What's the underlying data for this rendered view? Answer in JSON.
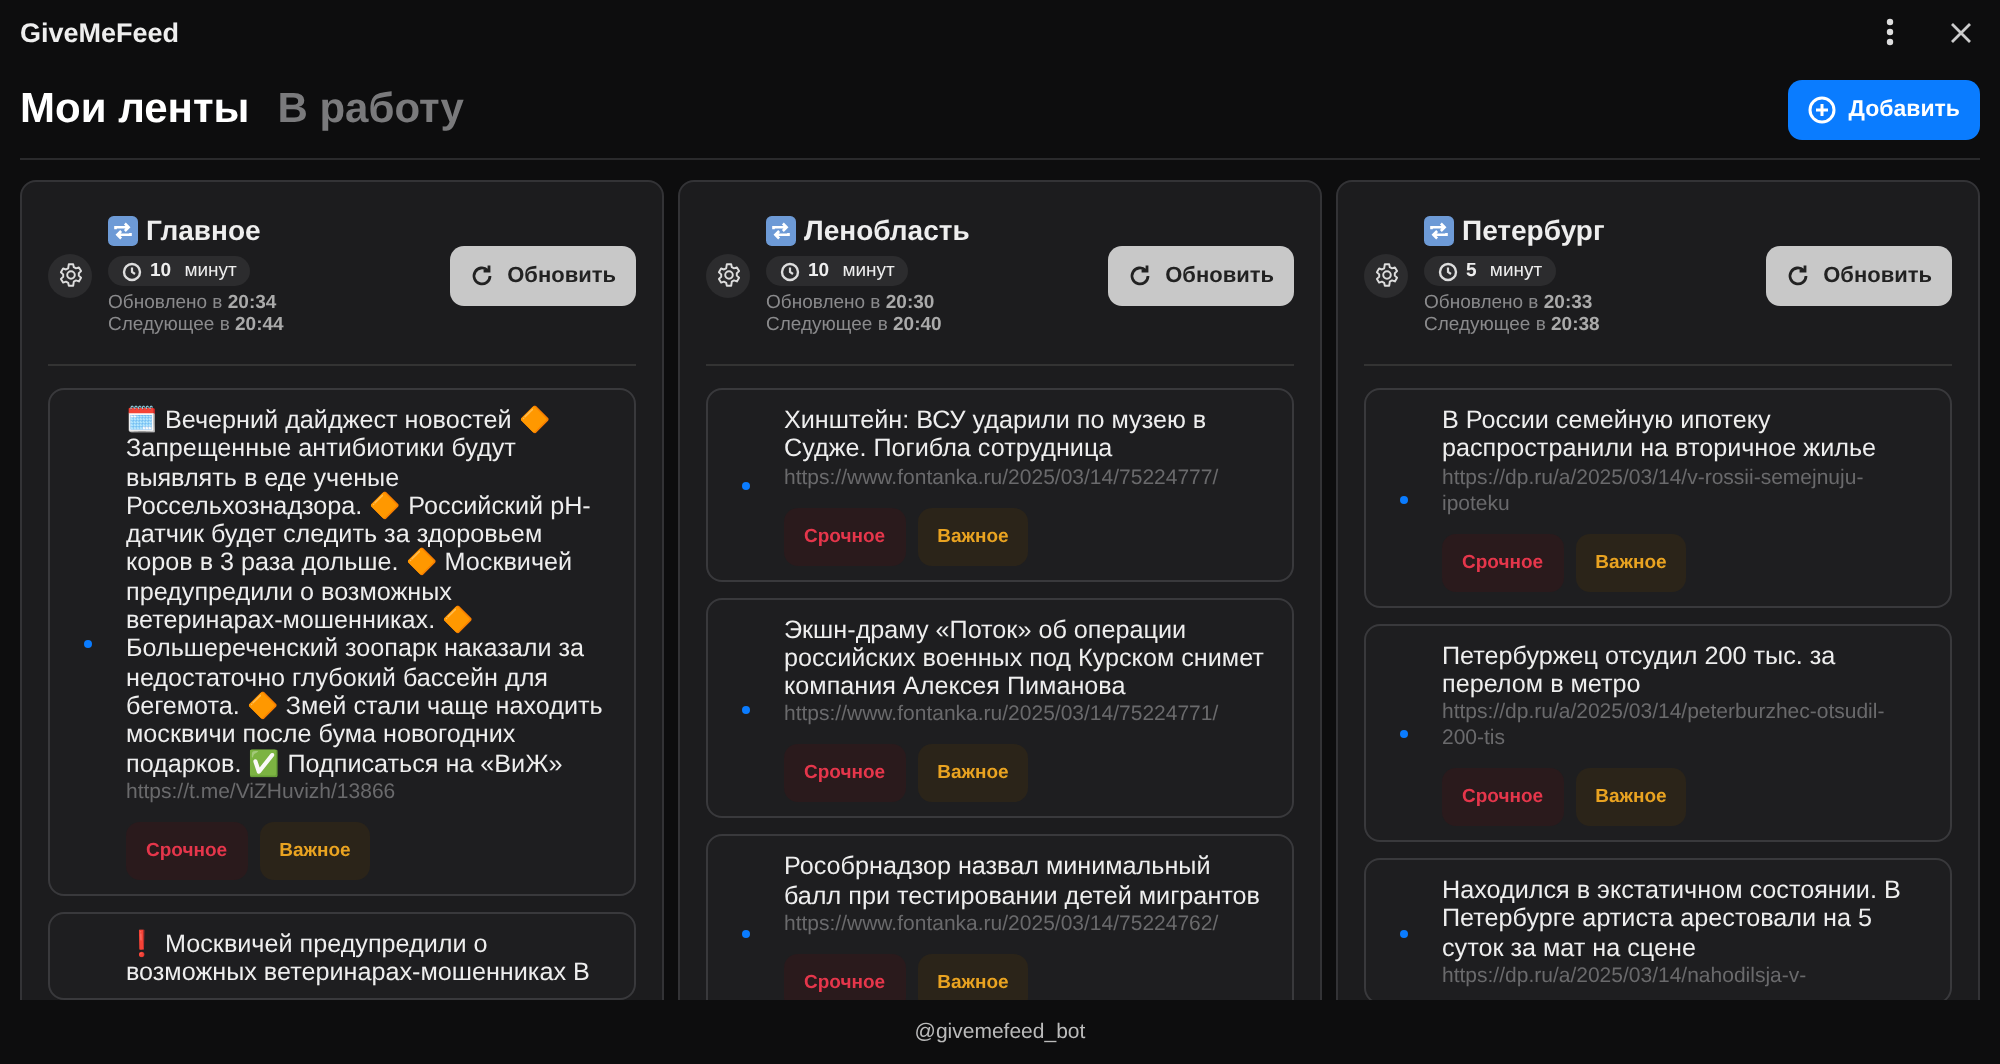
{
  "app": {
    "title": "GiveMeFeed"
  },
  "tabs": [
    {
      "label": "Мои ленты",
      "selected": true
    },
    {
      "label": "В работу",
      "selected": false
    }
  ],
  "add_button": "Добавить",
  "feeds": [
    {
      "name": "Главное",
      "interval": "10 минут",
      "updated_label": "Обновлено в",
      "updated": "20:34",
      "next_label": "Следующее в",
      "next": "20:44",
      "refresh": "Обновить",
      "items": [
        {
          "text": "🗓️ Вечерний дайджест новостей 🔶 Запрещенные антибиотики будут выявлять в еде ученые Россельхознадзора.  🔶 Российский pH-датчик будет следить за здоровьем коров в 3 раза дольше.  🔶 Москвичей предупредили о возможных ветеринарах-мошенниках. 🔶 Большереченский зоопарк наказали за недостаточно глубокий бассейн для бегемота.  🔶 Змей стали чаще находить москвичи после бума новогодних подарков.  ✅ Подписаться на «ВиЖ»",
          "url": "https://t.me/ViZHuvizh/13866",
          "unread": true,
          "tags": [
            {
              "label": "Срочное",
              "kind": "urgent"
            },
            {
              "label": "Важное",
              "kind": "important"
            }
          ]
        },
        {
          "text": "❗ Москвичей предупредили о возможных ветеринарах-мошенниках В",
          "unread": false
        }
      ]
    },
    {
      "name": "Ленобласть",
      "interval": "10 минут",
      "updated_label": "Обновлено в",
      "updated": "20:30",
      "next_label": "Следующее в",
      "next": "20:40",
      "refresh": "Обновить",
      "items": [
        {
          "text": "Хинштейн: ВСУ ударили по музею в Судже. Погибла сотрудница",
          "url": "https://www.fontanka.ru/2025/03/14/75224777/",
          "unread": true,
          "tags": [
            {
              "label": "Срочное",
              "kind": "urgent"
            },
            {
              "label": "Важное",
              "kind": "important"
            }
          ]
        },
        {
          "text": "Экшн-драму «Поток» об операции российских военных под Курском снимет компания Алексея Пиманова",
          "url": "https://www.fontanka.ru/2025/03/14/75224771/",
          "unread": true,
          "tags": [
            {
              "label": "Срочное",
              "kind": "urgent"
            },
            {
              "label": "Важное",
              "kind": "important"
            }
          ]
        },
        {
          "text": "Рособрнадзор назвал минимальный балл при тестировании детей мигрантов",
          "url": "https://www.fontanka.ru/2025/03/14/75224762/",
          "unread": true,
          "tags": [
            {
              "label": "Срочное",
              "kind": "urgent"
            },
            {
              "label": "Важное",
              "kind": "important"
            }
          ]
        }
      ]
    },
    {
      "name": "Петербург",
      "interval": "5 минут",
      "updated_label": "Обновлено в",
      "updated": "20:33",
      "next_label": "Следующее в",
      "next": "20:38",
      "refresh": "Обновить",
      "items": [
        {
          "text": "В России семейную ипотеку распространили на вторичное жилье",
          "url": "https://dp.ru/a/2025/03/14/v-rossii-semejnuju-ipoteku",
          "unread": true,
          "tags": [
            {
              "label": "Срочное",
              "kind": "urgent"
            },
            {
              "label": "Важное",
              "kind": "important"
            }
          ]
        },
        {
          "text": "Петербуржец отсудил 200 тыс. за перелом в метро",
          "url": "https://dp.ru/a/2025/03/14/peterburzhec-otsudil-200-tis",
          "unread": true,
          "tags": [
            {
              "label": "Срочное",
              "kind": "urgent"
            },
            {
              "label": "Важное",
              "kind": "important"
            }
          ]
        },
        {
          "text": "Находился в экстатичном состоянии. В Петербурге артиста арестовали на 5 суток за мат на сцене",
          "url": "https://dp.ru/a/2025/03/14/nahodilsja-v-",
          "unread": true
        }
      ]
    }
  ],
  "footer": "@givemefeed_bot"
}
